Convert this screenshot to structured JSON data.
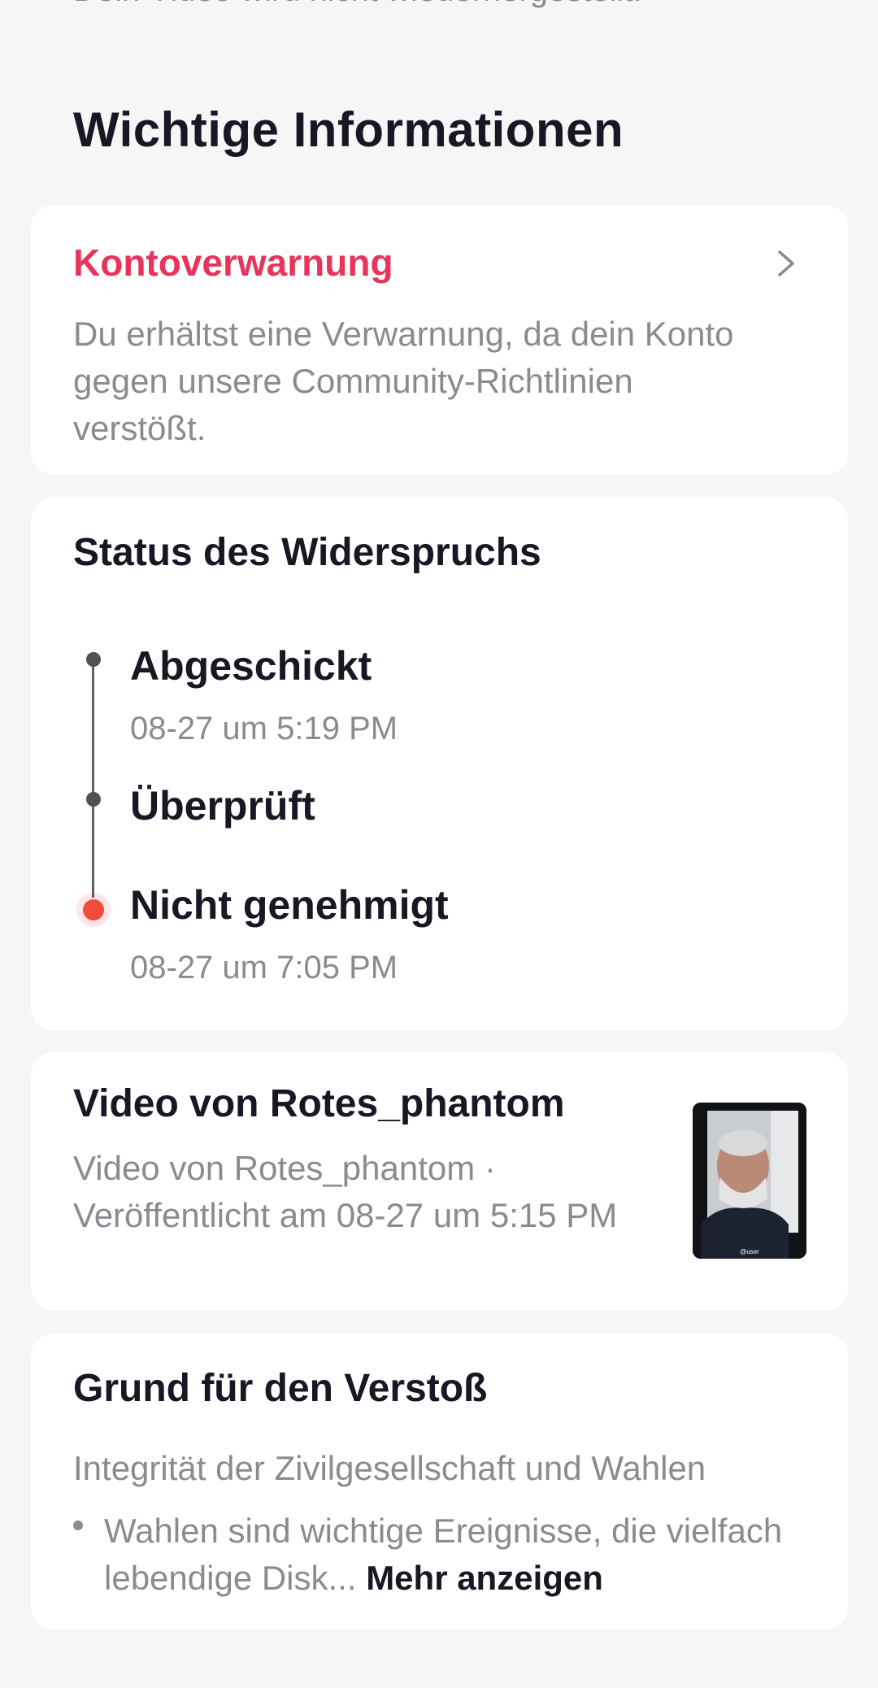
{
  "top_cut_text": "Dein Video wird nicht wiederhergestellt.",
  "section_title": "Wichtige Informationen",
  "warning": {
    "title": "Kontoverwarnung",
    "description": "Du erhältst eine Verwarnung, da dein Konto gegen unsere Community-Richtlinien verstößt.",
    "accent_color": "#e8345a"
  },
  "status": {
    "heading": "Status des Widerspruchs",
    "steps": [
      {
        "title": "Abgeschickt",
        "time": "08-27 um 5:19 PM"
      },
      {
        "title": "Überprüft",
        "time": ""
      },
      {
        "title": "Nicht genehmigt",
        "time": "08-27 um 7:05 PM"
      }
    ],
    "active_color": "#f24b3b"
  },
  "video": {
    "heading": "Video von Rotes_phantom",
    "description": "Video von Rotes_phantom · Veröffentlicht am 08-27 um 5:15 PM",
    "thumbnail_icon": "video-thumbnail"
  },
  "reason": {
    "heading": "Grund für den Verstoß",
    "category": "Integrität der Zivilgesellschaft und Wahlen",
    "text": "Wahlen sind wichtige Ereignisse, die vielfach lebendige Disk...",
    "more_label": "Mehr anzeigen"
  }
}
